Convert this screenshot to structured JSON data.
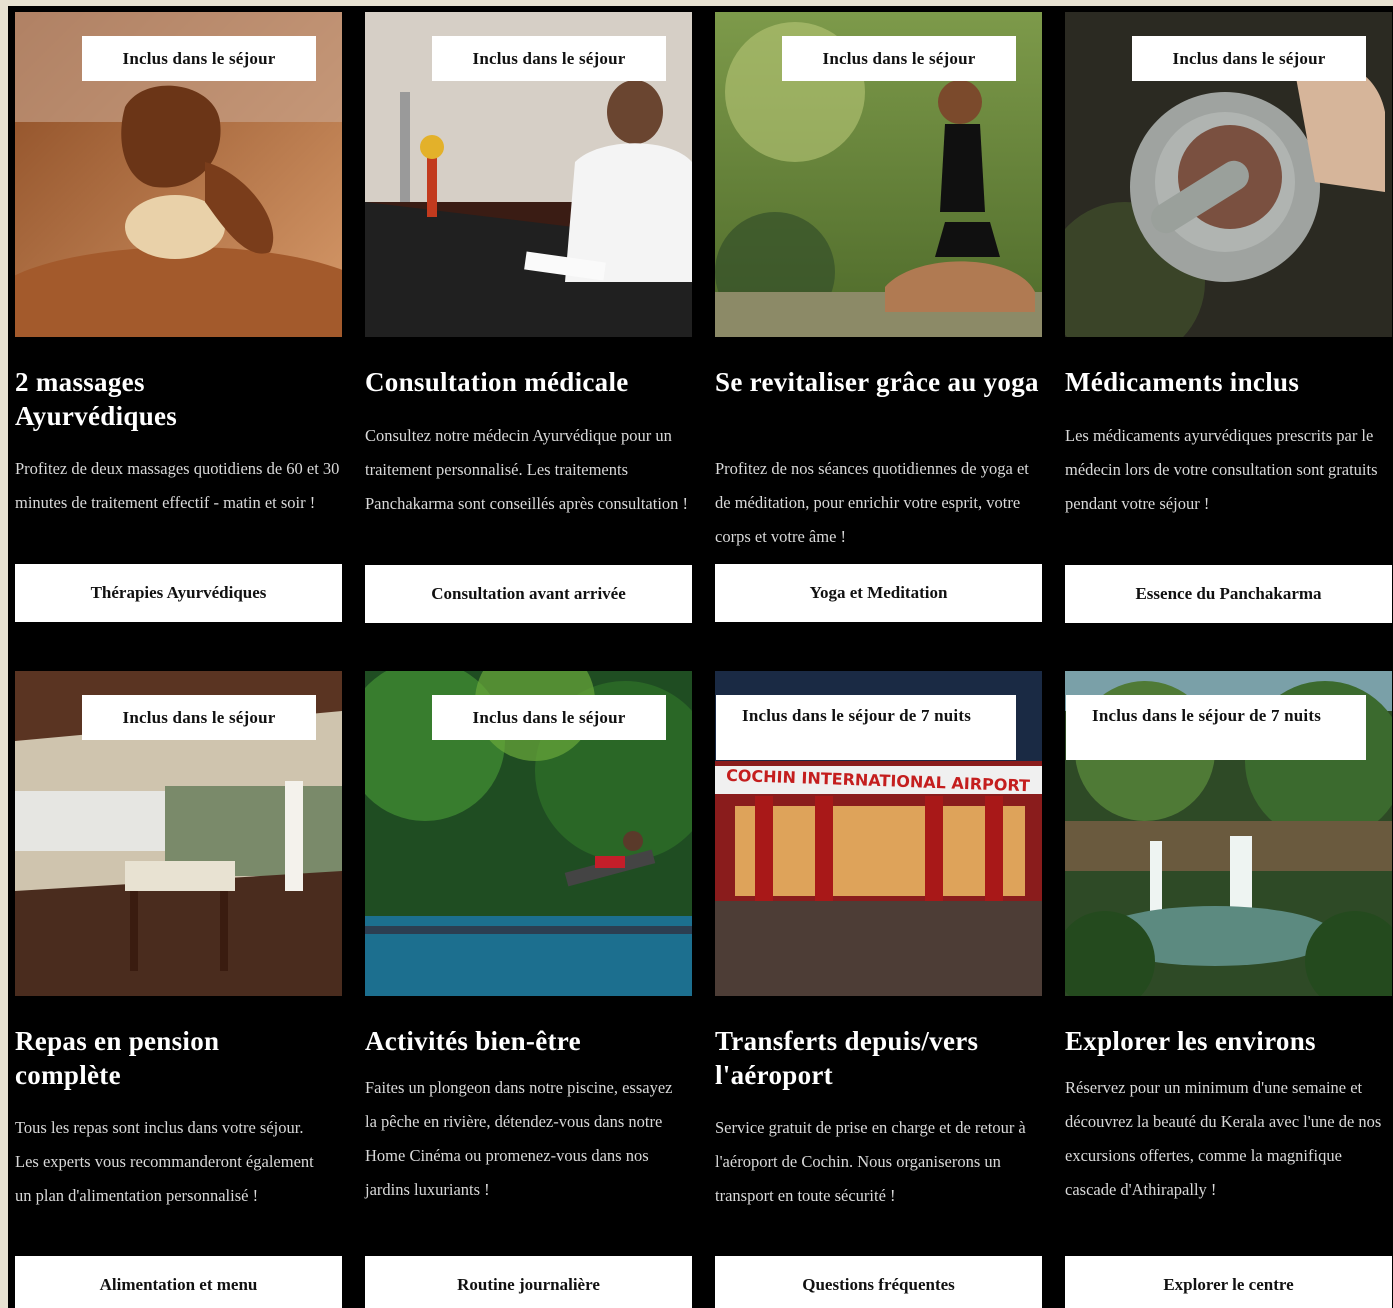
{
  "cards": [
    {
      "badge": "Inclus dans le séjour",
      "title": "2 massages Ayurvédiques",
      "description": "Profitez de deux massages quotidiens de 60 et 30 minutes de traitement effectif - matin et soir !",
      "button": "Thérapies Ayurvédiques"
    },
    {
      "badge": "Inclus dans le séjour",
      "title": "Consultation médicale",
      "description": "Consultez notre médecin Ayurvédique pour un traitement personnalisé. Les traitements Panchakarma sont conseillés après consultation !",
      "button": "Consultation avant arrivée"
    },
    {
      "badge": "Inclus dans le séjour",
      "title": "Se revitaliser grâce au yoga",
      "description": "Profitez de nos séances quotidiennes de yoga et de méditation, pour enrichir votre esprit, votre corps et votre âme !",
      "button": "Yoga et Meditation"
    },
    {
      "badge": "Inclus dans le séjour",
      "title": "Médicaments inclus",
      "description": "Les médicaments ayurvédiques prescrits par le médecin lors de votre consultation sont gratuits pendant votre séjour !",
      "button": "Essence du Panchakarma"
    },
    {
      "badge": "Inclus dans le séjour",
      "title": "Repas en pension complète",
      "description": "Tous les repas sont inclus dans votre séjour. Les experts vous recommanderont également un plan d'alimentation personnalisé !",
      "button": "Alimentation et menu"
    },
    {
      "badge": "Inclus dans le séjour",
      "title": "Activités bien-être",
      "description": "Faites un plongeon dans notre piscine, essayez la pêche en rivière, détendez-vous dans notre Home Cinéma ou promenez-vous dans nos jardins luxuriants !",
      "button": "Routine journalière"
    },
    {
      "badge": "Inclus dans le séjour de 7 nuits",
      "title": "Transferts depuis/vers l'aéroport",
      "description": "Service gratuit de prise en charge et de retour à l'aéroport de Cochin. Nous organiserons un transport en toute sécurité !",
      "button": "Questions fréquentes",
      "photo_sign": "COCHIN INTERNATIONAL AIRPORT"
    },
    {
      "badge": "Inclus dans le séjour de 7 nuits",
      "title": "Explorer les environs",
      "description": "Réservez pour un minimum d'une semaine et découvrez la beauté du Kerala avec l'une de nos excursions offertes, comme la magnifique cascade d'Athirapally !",
      "button": "Explorer le centre"
    }
  ],
  "colors": {
    "background": "#000000",
    "text": "#ffffff",
    "description": "#d9d9d9",
    "button_bg": "#ffffff"
  }
}
